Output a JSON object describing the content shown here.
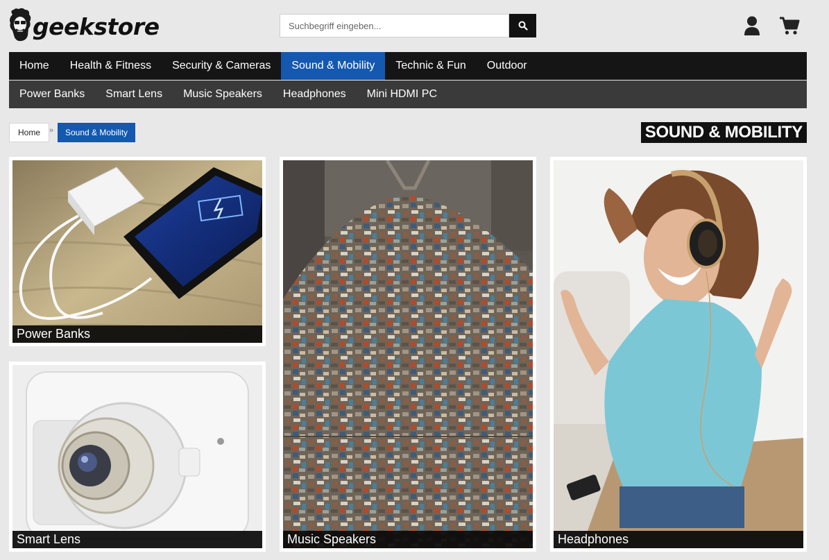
{
  "header": {
    "logo_text": "geekstore",
    "search_placeholder": "Suchbegriff eingeben..."
  },
  "nav": {
    "main": [
      "Home",
      "Health & Fitness",
      "Security & Cameras",
      "Sound & Mobility",
      "Technic & Fun",
      "Outdoor"
    ],
    "active_index": 3,
    "sub": [
      "Power Banks",
      "Smart Lens",
      "Music Speakers",
      "Headphones",
      "Mini HDMI PC"
    ]
  },
  "breadcrumb": {
    "home": "Home",
    "separator": "»",
    "current": "Sound & Mobility"
  },
  "page_title": "SOUND & MOBILITY",
  "tiles": [
    {
      "label": "Power Banks",
      "image": "powerbank-charging-phone"
    },
    {
      "label": "Smart Lens",
      "image": "sony-lens-camera"
    },
    {
      "label": "Music Speakers",
      "image": "garbage-pile"
    },
    {
      "label": "Headphones",
      "image": "woman-with-headphones"
    }
  ],
  "colors": {
    "accent": "#1458b0",
    "nav_bg": "#151515",
    "subnav_bg": "#3a3a3a",
    "page_bg": "#e8e8e8"
  },
  "icons": {
    "search": "magnifier-icon",
    "user": "user-icon",
    "cart": "cart-icon"
  }
}
